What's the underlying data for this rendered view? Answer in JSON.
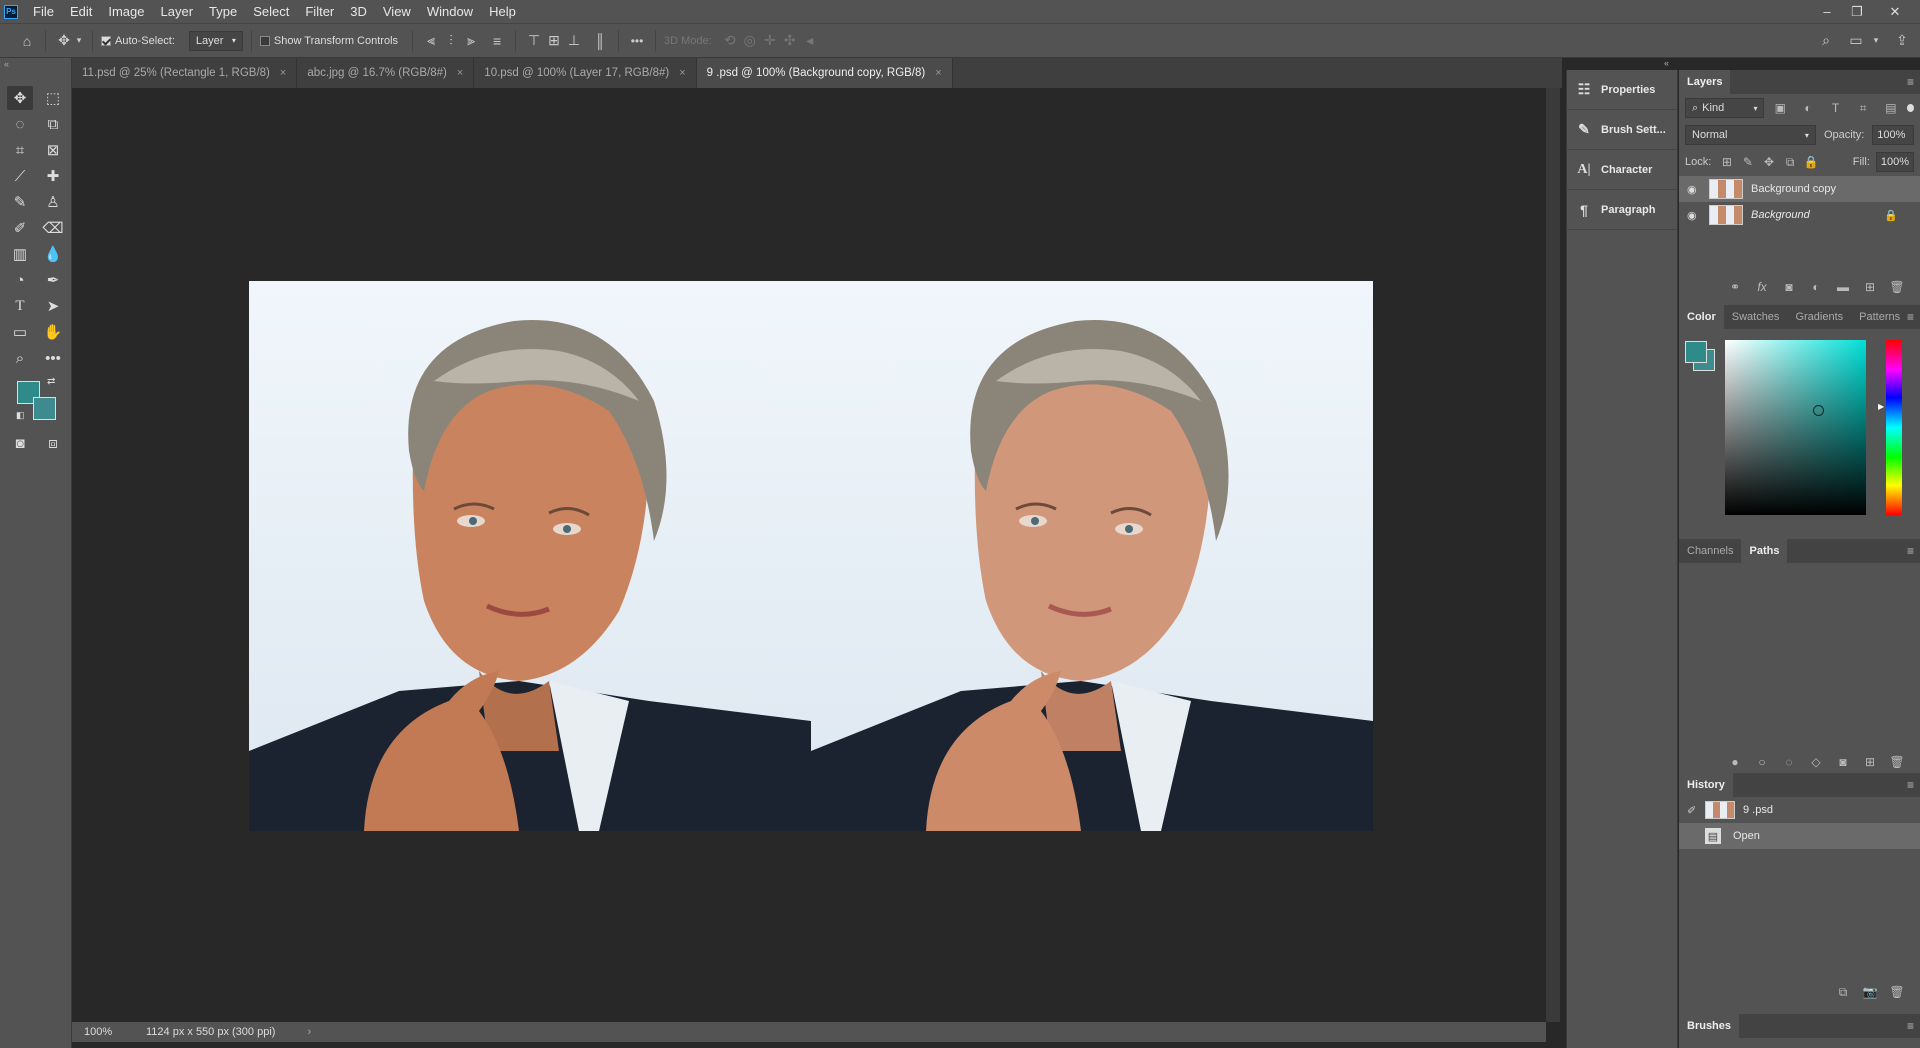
{
  "app": {
    "logo": "Ps"
  },
  "menu": [
    "File",
    "Edit",
    "Image",
    "Layer",
    "Type",
    "Select",
    "Filter",
    "3D",
    "View",
    "Window",
    "Help"
  ],
  "options": {
    "auto_select_label": "Auto-Select:",
    "auto_select_value": "Layer",
    "show_transform_label": "Show Transform Controls",
    "more": "•••",
    "mode3d_label": "3D Mode:"
  },
  "tabs": [
    {
      "label": "11.psd @ 25% (Rectangle 1, RGB/8)",
      "active": false
    },
    {
      "label": "abc.jpg @ 16.7% (RGB/8#)",
      "active": false
    },
    {
      "label": "10.psd @ 100% (Layer 17, RGB/8#)",
      "active": false
    },
    {
      "label": "9 .psd @ 100% (Background copy, RGB/8)",
      "active": true
    }
  ],
  "tab_close": "×",
  "status": {
    "zoom": "100%",
    "doc_info": "1124 px x 550 px (300 ppi)",
    "arrow": "›"
  },
  "colors": {
    "foreground": "#2f8a8a",
    "background": "#3d8a8f",
    "accent": "#31a8ff"
  },
  "collapsed_panels": [
    {
      "label": "Properties",
      "icon": "properties-icon"
    },
    {
      "label": "Brush Sett...",
      "icon": "brush-settings-icon"
    },
    {
      "label": "Character",
      "icon": "character-icon"
    },
    {
      "label": "Paragraph",
      "icon": "paragraph-icon"
    }
  ],
  "layers_panel": {
    "title": "Layers",
    "kind": "Kind",
    "blend_mode": "Normal",
    "opacity_label": "Opacity:",
    "opacity_value": "100%",
    "lock_label": "Lock:",
    "fill_label": "Fill:",
    "fill_value": "100%",
    "layers": [
      {
        "name": "Background copy",
        "selected": true,
        "locked": false
      },
      {
        "name": "Background",
        "selected": false,
        "locked": true
      }
    ]
  },
  "color_panel": {
    "tabs": [
      "Color",
      "Swatches",
      "Gradients",
      "Patterns"
    ]
  },
  "paths_panel": {
    "tabs": [
      "Channels",
      "Paths"
    ]
  },
  "history_panel": {
    "title": "History",
    "items": [
      {
        "name": "9 .psd",
        "snapshot": true
      },
      {
        "name": "Open",
        "snapshot": false
      }
    ]
  },
  "brushes_panel": {
    "title": "Brushes"
  }
}
